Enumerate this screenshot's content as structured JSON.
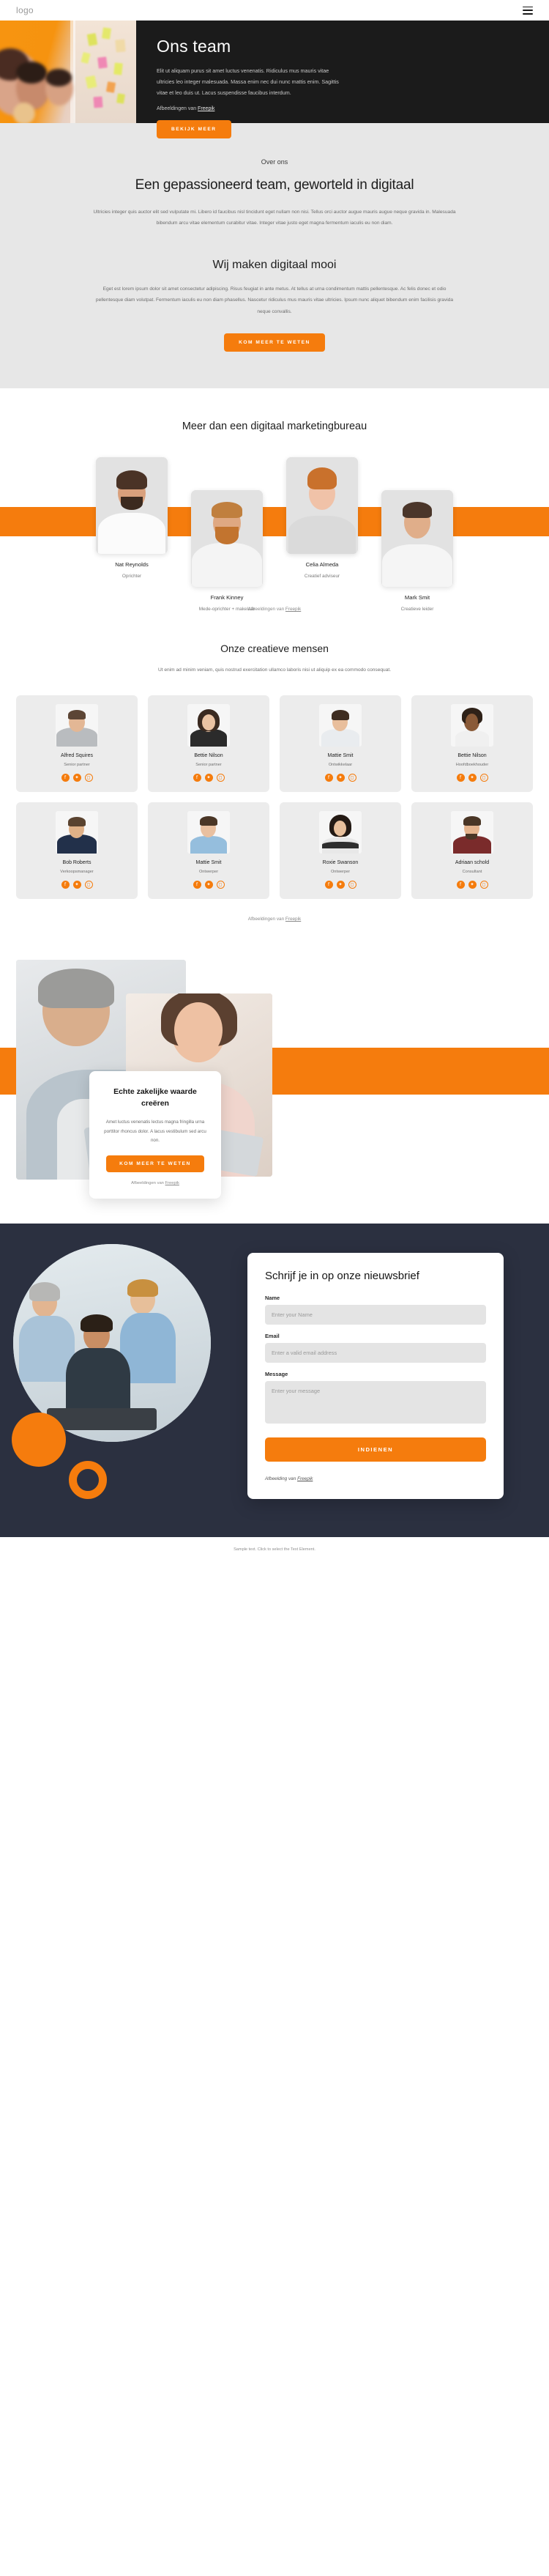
{
  "header": {
    "logo": "logo",
    "menu_icon": "hamburger-menu-icon"
  },
  "hero": {
    "title": "Ons team",
    "paragraph": "Elit ut aliquam purus sit amet luctus venenatis. Ridiculus mus mauris vitae ultricies leo integer malesuada. Massa enim nec dui nunc mattis enim. Sagittis vitae et leo duis ut. Lacus suspendisse faucibus interdum.",
    "credit_prefix": "Afbeeldingen van ",
    "credit_link": "Freepik",
    "cta": "BEKIJK MEER"
  },
  "about": {
    "eyebrow": "Over ons",
    "title": "Een gepassioneerd team, geworteld in digitaal",
    "paragraph": "Ultricies integer quis auctor elit sed vulputate mi. Libero id faucibus nisl tincidunt eget nullam non nisi. Tellus orci auctor augue mauris augue neque gravida in. Malesuada bibendum arcu vitae elementum curabitur vitae. Integer vitae justo eget magna fermentum iaculis eu non diam.",
    "sub_title": "Wij maken digitaal mooi",
    "sub_paragraph": "Eget est lorem ipsum dolor sit amet consectetur adipiscing. Risus feugiat in ante metus. At tellus at urna condimentum mattis pellentesque. Ac felis donec et odio pellentesque diam volutpat. Fermentum iaculis eu non diam phasellus. Nascetur ridiculus mus mauris vitae ultricies. Ipsum nunc aliquet bibendum enim facilisis gravida neque convallis.",
    "cta": "KOM MEER TE WETEN"
  },
  "leadteam": {
    "title": "Meer dan een digitaal marketingbureau",
    "members": [
      {
        "name": "Nat Reynolds",
        "role": "Oprichter",
        "offset": "high"
      },
      {
        "name": "Frank Kinney",
        "role": "Mede-oprichter + makelaar",
        "offset": "low"
      },
      {
        "name": "Celia Almeda",
        "role": "Creatief adviseur",
        "offset": "high"
      },
      {
        "name": "Mark Smit",
        "role": "Creatieve leider",
        "offset": "low"
      }
    ],
    "credit_prefix": "Afbeeldingen van ",
    "credit_link": "Freepik"
  },
  "creatives": {
    "title": "Onze creatieve mensen",
    "paragraph": "Ut enim ad minim veniam, quis nostrud exercitation ullamco laboris nisi ut aliquip ex ea commodo consequat.",
    "people": [
      {
        "name": "Alfred Squires",
        "role": "Senior partner"
      },
      {
        "name": "Bettie Nilson",
        "role": "Senior partner"
      },
      {
        "name": "Mattie Smit",
        "role": "Ontwikkelaar"
      },
      {
        "name": "Bettie Nilson",
        "role": "Hoofdboekhouder"
      },
      {
        "name": "Bob Roberts",
        "role": "Verkoopsmanager"
      },
      {
        "name": "Mattie Smit",
        "role": "Ontwerper"
      },
      {
        "name": "Roxie Swanson",
        "role": "Ontwerper"
      },
      {
        "name": "Adriaan schold",
        "role": "Consultant"
      }
    ],
    "social_icons": [
      "facebook-icon",
      "twitter-icon",
      "instagram-icon"
    ],
    "credit_prefix": "Afbeeldingen van ",
    "credit_link": "Freepik"
  },
  "value": {
    "title": "Echte zakelijke waarde creëren",
    "paragraph": "Amet luctus venenatis lectus magna fringilla urna porttitor rhoncus dolor. A lacus vestibulum sed arcu non.",
    "cta": "KOM MEER TE WETEN",
    "credit_prefix": "Afbeeldingen van ",
    "credit_link": "Freepik"
  },
  "newsletter": {
    "title": "Schrijf je in op onze nieuwsbrief",
    "fields": [
      {
        "label": "Name",
        "placeholder": "Enter your Name",
        "value": ""
      },
      {
        "label": "Email",
        "placeholder": "Enter a valid email address",
        "value": ""
      },
      {
        "label": "Message",
        "placeholder": "Enter your message",
        "value": ""
      }
    ],
    "submit": "INDIENEN",
    "credit_prefix": "Afbeelding van ",
    "credit_link": "Freepik"
  },
  "footer": {
    "text": "Sample text. Click to select the Text Element."
  },
  "colors": {
    "accent": "#f57c0d",
    "hero_panel": "#1b1b1b",
    "about_bg": "#e7e7e7",
    "newsletter_bg": "#2b3040",
    "card_bg": "#ececec"
  }
}
